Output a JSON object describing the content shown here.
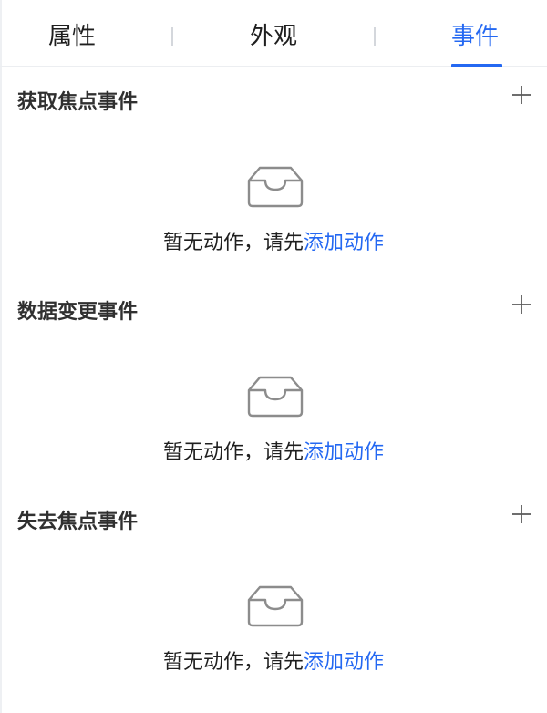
{
  "tabs": [
    {
      "label": "属性",
      "active": false
    },
    {
      "label": "外观",
      "active": false
    },
    {
      "label": "事件",
      "active": true
    }
  ],
  "accent_color": "#2468f2",
  "sections": [
    {
      "title": "获取焦点事件",
      "add_icon": "plus-icon",
      "empty_icon": "inbox-icon",
      "empty_text": "暂无动作，请先",
      "empty_link": "添加动作"
    },
    {
      "title": "数据变更事件",
      "add_icon": "plus-icon",
      "empty_icon": "inbox-icon",
      "empty_text": "暂无动作，请先",
      "empty_link": "添加动作"
    },
    {
      "title": "失去焦点事件",
      "add_icon": "plus-icon",
      "empty_icon": "inbox-icon",
      "empty_text": "暂无动作，请先",
      "empty_link": "添加动作"
    }
  ]
}
